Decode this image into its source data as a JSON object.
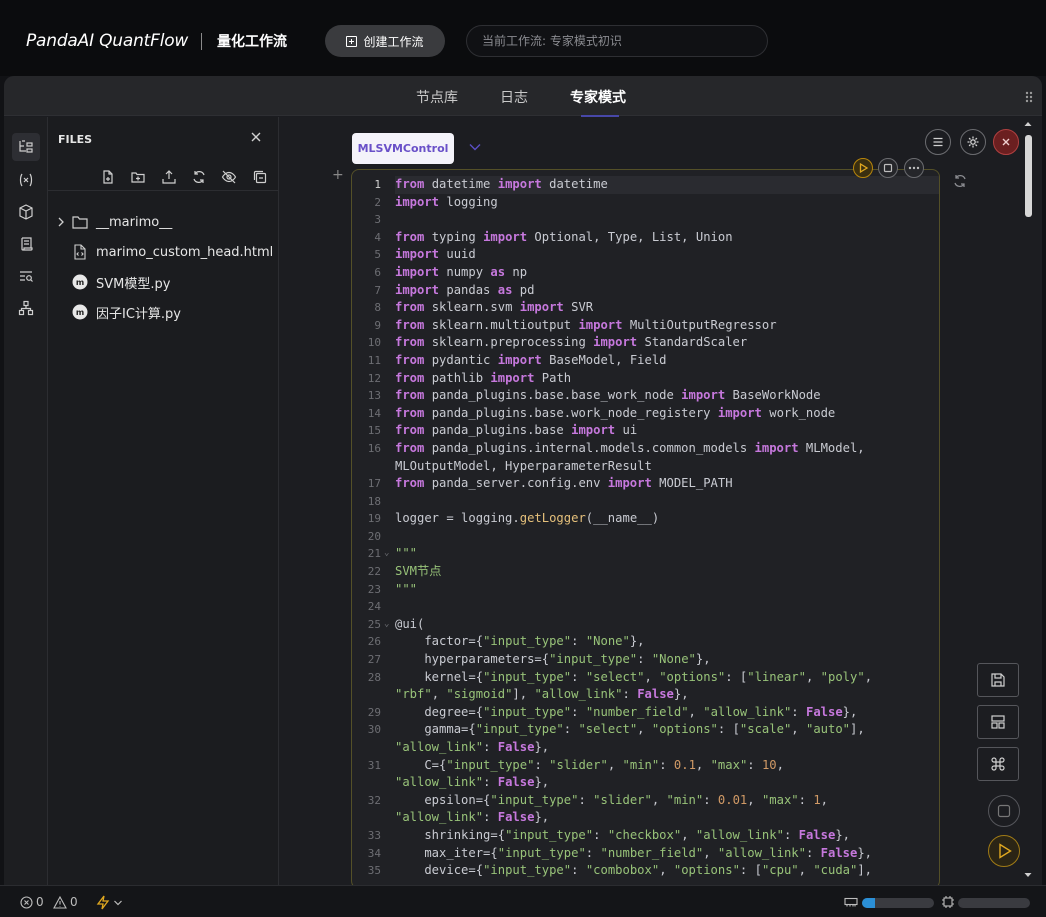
{
  "header": {
    "brand": "PandaAI QuantFlow",
    "subtitle": "量化工作流",
    "create_label": "创建工作流",
    "current_workflow": "当前工作流:  专家模式初识"
  },
  "tabs": [
    {
      "label": "节点库",
      "active": false
    },
    {
      "label": "日志",
      "active": false
    },
    {
      "label": "专家模式",
      "active": true
    }
  ],
  "sidebar_icons": [
    "files-tree-icon",
    "variables-icon",
    "package-icon",
    "scroll-icon",
    "search-list-icon",
    "hierarchy-icon"
  ],
  "files": {
    "title": "FILES",
    "items": [
      {
        "name": "__marimo__",
        "type": "folder"
      },
      {
        "name": "marimo_custom_head.html",
        "type": "html-file"
      },
      {
        "name": "SVM模型.py",
        "type": "marimo-file"
      },
      {
        "name": "因子IC计算.py",
        "type": "marimo-file"
      }
    ]
  },
  "cell": {
    "name": "MLSVMControl"
  },
  "code_lines": [
    {
      "n": "1",
      "src": "<span class=kw>from</span> datetime <span class=kw>import</span> datetime"
    },
    {
      "n": "2",
      "src": "<span class=kw>import</span> logging"
    },
    {
      "n": "3",
      "src": ""
    },
    {
      "n": "4",
      "src": "<span class=kw>from</span> typing <span class=kw>import</span> Optional, Type, List, Union"
    },
    {
      "n": "5",
      "src": "<span class=kw>import</span> uuid"
    },
    {
      "n": "6",
      "src": "<span class=kw>import</span> numpy <span class=kw>as</span> np"
    },
    {
      "n": "7",
      "src": "<span class=kw>import</span> pandas <span class=kw>as</span> pd"
    },
    {
      "n": "8",
      "src": "<span class=kw>from</span> sklearn.svm <span class=kw>import</span> SVR"
    },
    {
      "n": "9",
      "src": "<span class=kw>from</span> sklearn.multioutput <span class=kw>import</span> MultiOutputRegressor"
    },
    {
      "n": "10",
      "src": "<span class=kw>from</span> sklearn.preprocessing <span class=kw>import</span> StandardScaler"
    },
    {
      "n": "11",
      "src": "<span class=kw>from</span> pydantic <span class=kw>import</span> BaseModel, Field"
    },
    {
      "n": "12",
      "src": "<span class=kw>from</span> pathlib <span class=kw>import</span> Path"
    },
    {
      "n": "13",
      "src": "<span class=kw>from</span> panda_plugins.base.base_work_node <span class=kw>import</span> BaseWorkNode"
    },
    {
      "n": "14",
      "src": "<span class=kw>from</span> panda_plugins.base.work_node_registery <span class=kw>import</span> work_node"
    },
    {
      "n": "15",
      "src": "<span class=kw>from</span> panda_plugins.base <span class=kw>import</span> ui"
    },
    {
      "n": "16",
      "src": "<span class=kw>from</span> panda_plugins.internal.models.common_models <span class=kw>import</span> MLModel,"
    },
    {
      "n": "",
      "src": "MLOutputModel, HyperparameterResult"
    },
    {
      "n": "17",
      "src": "<span class=kw>from</span> panda_server.config.env <span class=kw>import</span> MODEL_PATH"
    },
    {
      "n": "18",
      "src": ""
    },
    {
      "n": "19",
      "src": "logger = logging.<span class=fn>getLogger</span>(__name__)"
    },
    {
      "n": "20",
      "src": ""
    },
    {
      "n": "21",
      "fold": true,
      "src": "<span class=cm>\"\"\"</span>"
    },
    {
      "n": "22",
      "src": "<span class=cm>SVM节点</span>"
    },
    {
      "n": "23",
      "src": "<span class=cm>\"\"\"</span>"
    },
    {
      "n": "24",
      "src": ""
    },
    {
      "n": "25",
      "fold": true,
      "src": "@ui("
    },
    {
      "n": "26",
      "src": "    factor={<span class=str>\"input_type\"</span>: <span class=str>\"None\"</span>},"
    },
    {
      "n": "27",
      "src": "    hyperparameters={<span class=str>\"input_type\"</span>: <span class=str>\"None\"</span>},"
    },
    {
      "n": "28",
      "src": "    kernel={<span class=str>\"input_type\"</span>: <span class=str>\"select\"</span>, <span class=str>\"options\"</span>: [<span class=str>\"linear\"</span>, <span class=str>\"poly\"</span>,"
    },
    {
      "n": "",
      "src": "<span class=str>\"rbf\"</span>, <span class=str>\"sigmoid\"</span>], <span class=str>\"allow_link\"</span>: <span class=kw>False</span>},"
    },
    {
      "n": "29",
      "src": "    degree={<span class=str>\"input_type\"</span>: <span class=str>\"number_field\"</span>, <span class=str>\"allow_link\"</span>: <span class=kw>False</span>},"
    },
    {
      "n": "30",
      "src": "    gamma={<span class=str>\"input_type\"</span>: <span class=str>\"select\"</span>, <span class=str>\"options\"</span>: [<span class=str>\"scale\"</span>, <span class=str>\"auto\"</span>],"
    },
    {
      "n": "",
      "src": "<span class=str>\"allow_link\"</span>: <span class=kw>False</span>},"
    },
    {
      "n": "31",
      "src": "    C={<span class=str>\"input_type\"</span>: <span class=str>\"slider\"</span>, <span class=str>\"min\"</span>: <span class=num>0.1</span>, <span class=str>\"max\"</span>: <span class=num>10</span>,"
    },
    {
      "n": "",
      "src": "<span class=str>\"allow_link\"</span>: <span class=kw>False</span>},"
    },
    {
      "n": "32",
      "src": "    epsilon={<span class=str>\"input_type\"</span>: <span class=str>\"slider\"</span>, <span class=str>\"min\"</span>: <span class=num>0.01</span>, <span class=str>\"max\"</span>: <span class=num>1</span>,"
    },
    {
      "n": "",
      "src": "<span class=str>\"allow_link\"</span>: <span class=kw>False</span>},"
    },
    {
      "n": "33",
      "src": "    shrinking={<span class=str>\"input_type\"</span>: <span class=str>\"checkbox\"</span>, <span class=str>\"allow_link\"</span>: <span class=kw>False</span>},"
    },
    {
      "n": "34",
      "src": "    max_iter={<span class=str>\"input_type\"</span>: <span class=str>\"number_field\"</span>, <span class=str>\"allow_link\"</span>: <span class=kw>False</span>},"
    },
    {
      "n": "35",
      "src": "    device={<span class=str>\"input_type\"</span>: <span class=str>\"combobox\"</span>, <span class=str>\"options\"</span>: [<span class=str>\"cpu\"</span>, <span class=str>\"cuda\"</span>],"
    }
  ],
  "status": {
    "errors": "0",
    "warnings": "0",
    "memory_fraction": 0.18
  },
  "colors": {
    "accent": "#6950c8",
    "run": "#d4a017",
    "close": "#c0392b"
  }
}
